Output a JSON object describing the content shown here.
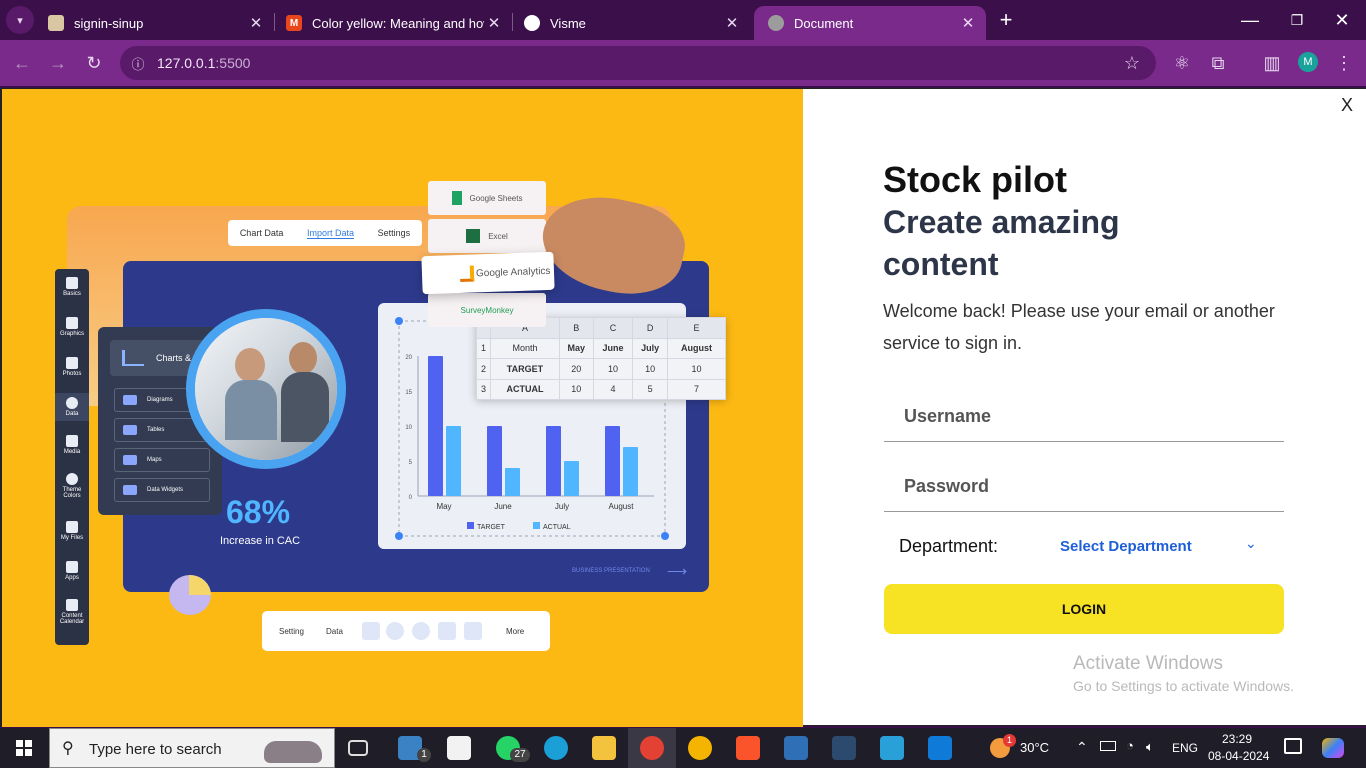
{
  "browser": {
    "tabs": [
      {
        "title": "signin-sinup",
        "favicon_color": "#d9c7a3"
      },
      {
        "title": "Color yellow: Meaning and how",
        "favicon_color": "#e9461c",
        "favicon_letter": "M"
      },
      {
        "title": "Visme",
        "favicon_color": "#ffffff"
      },
      {
        "title": "Document",
        "favicon_color": "#9c9c9c"
      }
    ],
    "new_tab": "+",
    "url_host": "127.0.0.1",
    "url_port": ":5500",
    "profile_initial": "M"
  },
  "hero": {
    "topbar": {
      "chart_data": "Chart Data",
      "import_data": "Import Data",
      "settings": "Settings"
    },
    "sidebar": [
      "Basics",
      "Graphics",
      "Photos",
      "Data",
      "Media",
      "Theme Colors",
      "My Files",
      "Apps",
      "Content Calendar"
    ],
    "panel_title": "Charts & Graphs",
    "panel_items": [
      "Diagrams",
      "Tables",
      "Maps",
      "Data Widgets"
    ],
    "kpi_value": "68%",
    "kpi_caption": "Increase in CAC",
    "connectors": {
      "sheets": "Google Sheets",
      "excel": "Excel",
      "analytics": "Google Analytics",
      "survey": "SurveyMonkey"
    },
    "footer_link": "BUSINESS PRESENTATION",
    "bottom_bar": {
      "setting": "Setting",
      "data": "Data",
      "more": "More"
    },
    "table": {
      "cols": [
        "",
        "A",
        "B",
        "C",
        "D",
        "E"
      ],
      "rows": [
        [
          "1",
          "Month",
          "May",
          "June",
          "July",
          "August"
        ],
        [
          "2",
          "TARGET",
          "20",
          "10",
          "10",
          "10"
        ],
        [
          "3",
          "ACTUAL",
          "10",
          "4",
          "5",
          "7"
        ]
      ]
    }
  },
  "chart_data": {
    "type": "bar",
    "categories": [
      "May",
      "June",
      "July",
      "August"
    ],
    "series": [
      {
        "name": "TARGET",
        "values": [
          20,
          10,
          10,
          10
        ],
        "color": "#4f63f0"
      },
      {
        "name": "ACTUAL",
        "values": [
          10,
          4,
          5,
          7
        ],
        "color": "#4fb6ff"
      }
    ],
    "ylim": [
      0,
      20
    ],
    "yticks": [
      "0",
      "5",
      "10",
      "15",
      "20"
    ],
    "legend": "bottom"
  },
  "login": {
    "close": "X",
    "brand": "Stock pilot",
    "headline": "Create amazing content",
    "welcome": "Welcome back! Please use your email or another service to sign in.",
    "username_placeholder": "Username",
    "password_placeholder": "Password",
    "department_label": "Department:",
    "department_value": "Select Department",
    "login_button": "LOGIN"
  },
  "watermark": {
    "title": "Activate Windows",
    "subtitle": "Go to Settings to activate Windows."
  },
  "taskbar": {
    "search_placeholder": "Type here to search",
    "mail_badge": "1",
    "whatsapp_badge": "27",
    "weather_badge": "1",
    "temperature": "30°C",
    "language": "ENG",
    "time": "23:29",
    "date": "08-04-2024"
  }
}
